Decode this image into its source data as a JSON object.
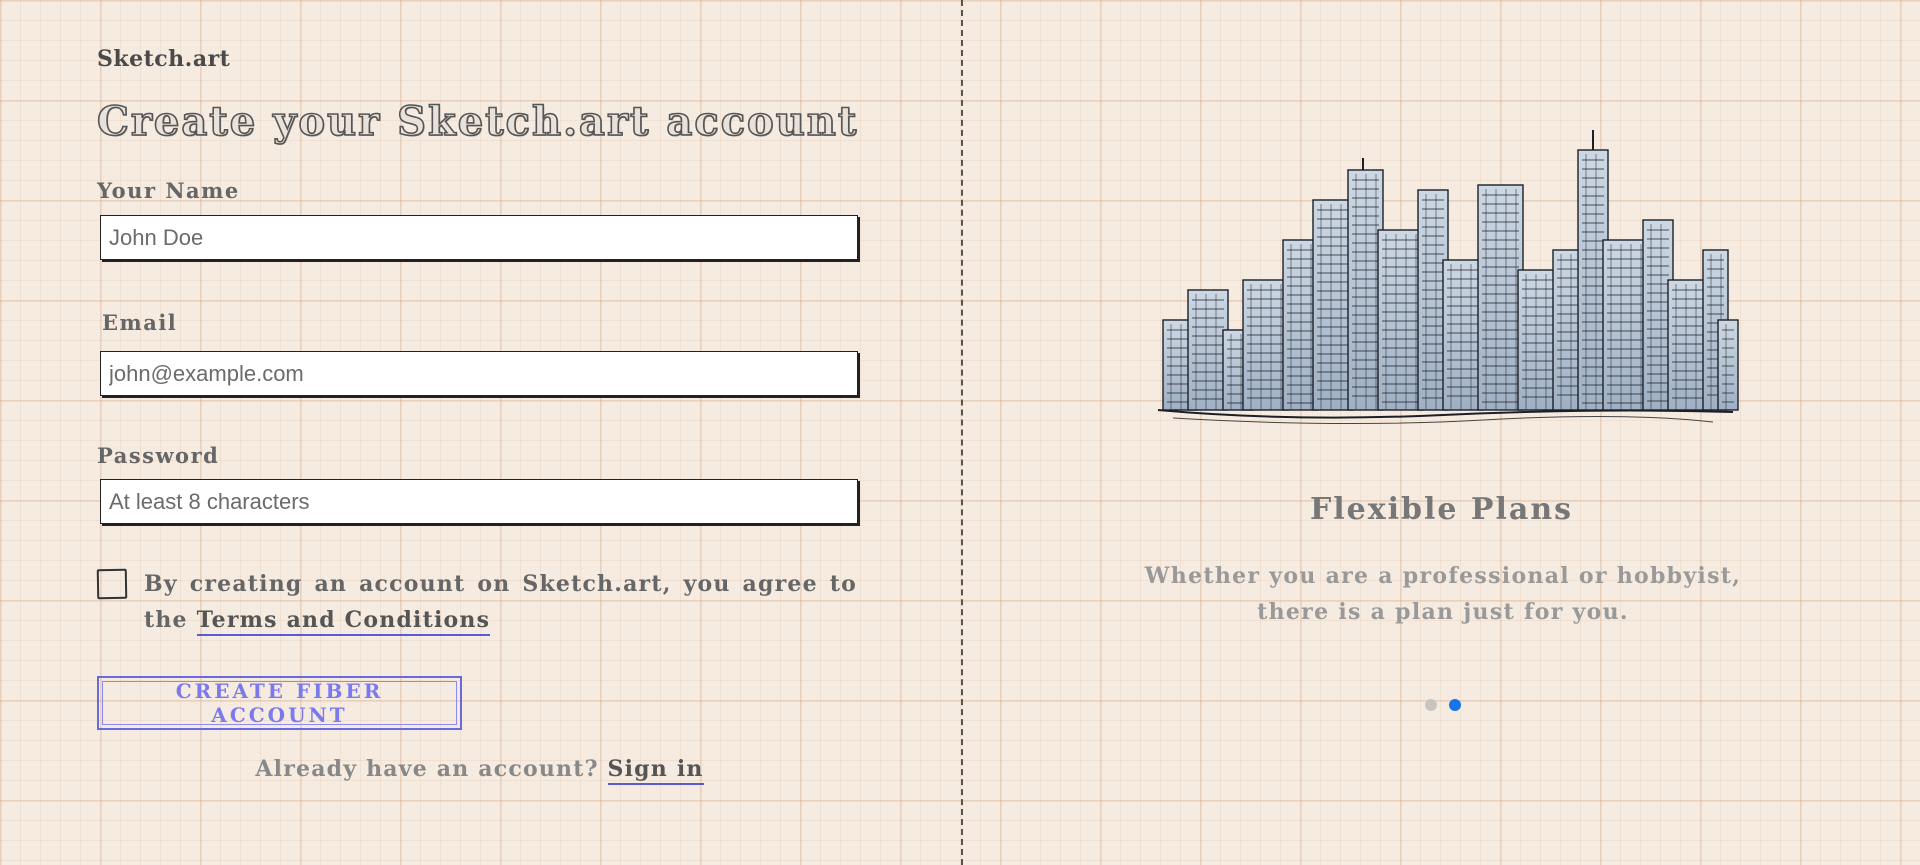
{
  "brand": "Sketch.art",
  "page_title": "Create your Sketch.art account",
  "form": {
    "name_label": "Your Name",
    "name_placeholder": "John Doe",
    "name_value": "",
    "email_label": "Email",
    "email_placeholder": "john@example.com",
    "email_value": "",
    "password_label": "Password",
    "password_placeholder": "At least 8 characters",
    "password_value": "",
    "terms_checked": false,
    "terms_text": "By creating an account on Sketch.art, you agree to the",
    "terms_link": "Terms and Conditions",
    "submit_label": "CREATE FIBER ACCOUNT",
    "signin_prompt": "Already have an account?",
    "signin_link": "Sign in"
  },
  "feature": {
    "image_icon": "city-skyline-sketch-icon",
    "title": "Flexible Plans",
    "description": "Whether you are a professional or hobbyist, there is a plan just for you."
  },
  "carousel": {
    "total": 2,
    "active_index": 1,
    "colors": {
      "inactive": "#c8c4c0",
      "active": "#1a73e8"
    }
  },
  "colors": {
    "accent": "#6a6ae0",
    "paper": "#f5ebe0"
  }
}
